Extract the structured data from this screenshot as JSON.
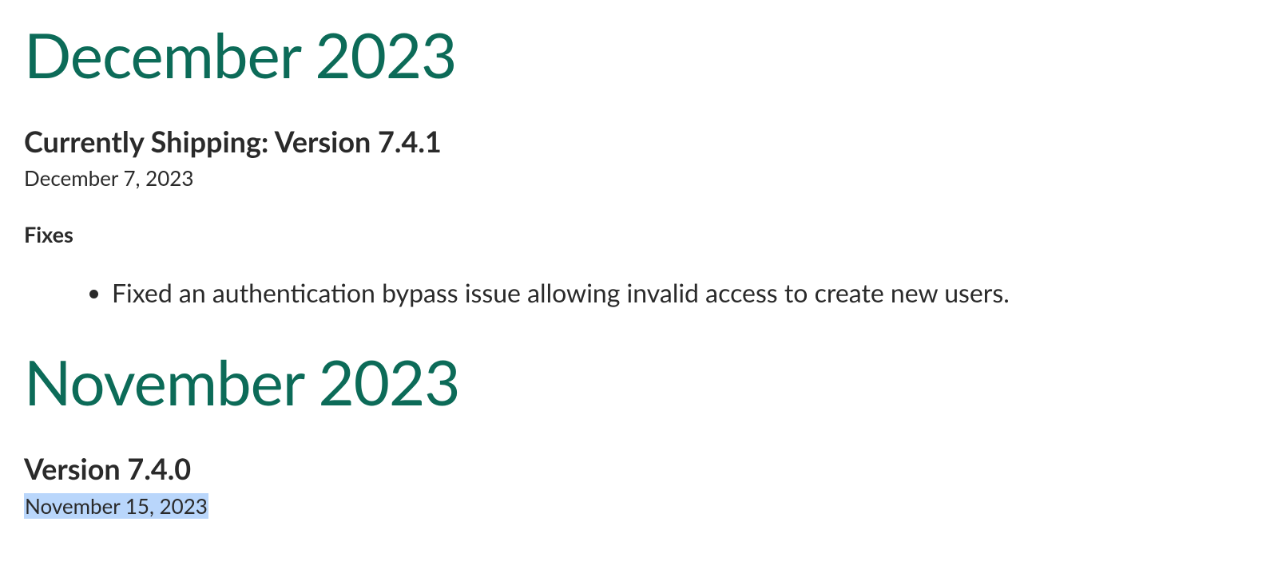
{
  "sections": [
    {
      "month_heading": "December 2023",
      "version_heading": "Currently Shipping: Version 7.4.1",
      "release_date": "December 7, 2023",
      "fixes_label": "Fixes",
      "fixes": [
        "Fixed an authentication bypass issue allowing invalid access to create new users."
      ]
    },
    {
      "month_heading": "November 2023",
      "version_heading": "Version 7.4.0",
      "release_date": "November 15, 2023",
      "release_date_highlighted": true
    }
  ]
}
